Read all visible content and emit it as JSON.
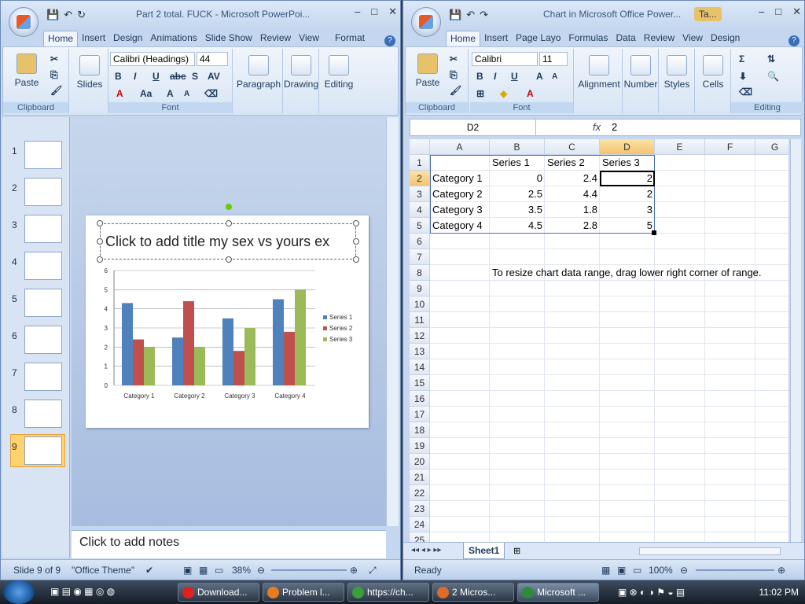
{
  "pp": {
    "title": "Part 2 total. FUCK - Microsoft PowerPoi...",
    "tabs": [
      "Home",
      "Insert",
      "Design",
      "Animations",
      "Slide Show",
      "Review",
      "View",
      "Format"
    ],
    "groups": {
      "clipboard": "Clipboard",
      "slides": "Slides",
      "font": "Font",
      "paragraph": "Paragraph",
      "drawing": "Drawing",
      "editing": "Editing"
    },
    "paste": "Paste",
    "font_name": "Calibri (Headings)",
    "font_size": "44",
    "slide_numbers": [
      "1",
      "2",
      "3",
      "4",
      "5",
      "6",
      "7",
      "8",
      "9"
    ],
    "slide_title": "Click to add title my sex vs yours ex",
    "notes": "Click to add notes",
    "status": {
      "slide": "Slide 9 of 9",
      "theme": "\"Office Theme\"",
      "zoom": "38%"
    }
  },
  "chart_data": {
    "type": "bar",
    "categories": [
      "Category 1",
      "Category 2",
      "Category 3",
      "Category 4"
    ],
    "series": [
      {
        "name": "Series 1",
        "values": [
          4.3,
          2.5,
          3.5,
          4.5
        ],
        "color": "#4f81bd"
      },
      {
        "name": "Series 2",
        "values": [
          2.4,
          4.4,
          1.8,
          2.8
        ],
        "color": "#c0504d"
      },
      {
        "name": "Series 3",
        "values": [
          2,
          2,
          3,
          5
        ],
        "color": "#9bbb59"
      }
    ],
    "yticks": [
      "0",
      "1",
      "2",
      "3",
      "4",
      "5",
      "6"
    ],
    "ylim": [
      0,
      6
    ],
    "legend": "right",
    "grid": true
  },
  "xl": {
    "title": "Chart in Microsoft Office Power...",
    "extra_tab": "Ta...",
    "tabs": [
      "Home",
      "Insert",
      "Page Layo",
      "Formulas",
      "Data",
      "Review",
      "View",
      "Design"
    ],
    "groups": {
      "clipboard": "Clipboard",
      "font": "Font",
      "alignment": "Alignment",
      "number": "Number",
      "styles": "Styles",
      "cells": "Cells",
      "editing": "Editing"
    },
    "paste": "Paste",
    "font_name": "Calibri",
    "font_size": "11",
    "namebox": "D2",
    "fx": "fx",
    "formula_value": "2",
    "columns": [
      "A",
      "B",
      "C",
      "D",
      "E",
      "F",
      "G"
    ],
    "rows": [
      "1",
      "2",
      "3",
      "4",
      "5",
      "6",
      "7",
      "8",
      "9",
      "10",
      "11",
      "12",
      "13",
      "14",
      "15",
      "16",
      "17",
      "18",
      "19",
      "20",
      "21",
      "22",
      "23",
      "24",
      "25"
    ],
    "header_row": [
      "",
      "Series 1",
      "Series 2",
      "Series 3"
    ],
    "data": [
      [
        "Category 1",
        "0",
        "2.4",
        "2"
      ],
      [
        "Category 2",
        "2.5",
        "4.4",
        "2"
      ],
      [
        "Category 3",
        "3.5",
        "1.8",
        "3"
      ],
      [
        "Category 4",
        "4.5",
        "2.8",
        "5"
      ]
    ],
    "note": "To resize chart data range, drag lower right corner of range.",
    "sheet_tab": "Sheet1",
    "status": {
      "ready": "Ready",
      "zoom": "100%"
    }
  },
  "taskbar": {
    "items": [
      "Download...",
      "Problem l...",
      "https://ch...",
      "2 Micros...",
      "Microsoft ..."
    ],
    "clock": "11:02 PM"
  }
}
